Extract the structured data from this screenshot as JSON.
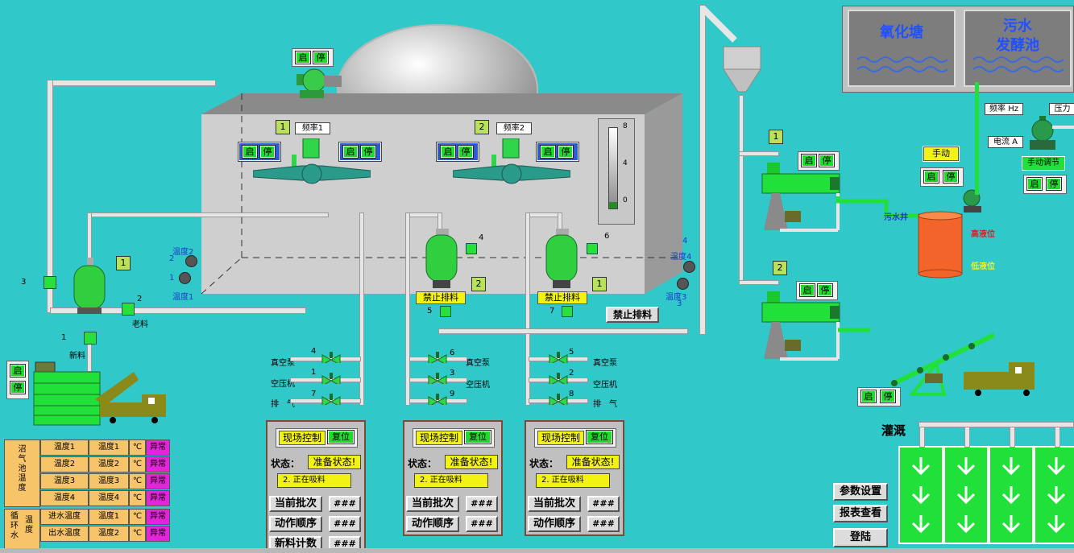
{
  "tanks": {
    "oxidation_pond": "氧化塘",
    "sewage_tank_line1": "污水",
    "sewage_tank_line2": "发酵池"
  },
  "buttons": {
    "start": "启",
    "stop": "停"
  },
  "digester": {
    "motor1_tag": "1",
    "motor1_label": "频率1",
    "motor2_tag": "2",
    "motor2_label": "频率2",
    "gauge_ticks": [
      "8",
      "4",
      "0"
    ],
    "temp2": "温度2",
    "temp2_num": "2",
    "temp1": "温度1",
    "temp1_num": "1",
    "temp3": "温度3",
    "temp3_num": "3",
    "temp4": "温度4",
    "temp4_num": "4"
  },
  "feed": {
    "tag1": "1",
    "valve3": "3",
    "valve2": "2",
    "valve1": "1",
    "old_feed": "老料",
    "new_feed": "新料"
  },
  "discharge": {
    "tank2_tag": "2",
    "tank1_tag": "1",
    "valve4": "4",
    "valve6": "6",
    "valve5": "5",
    "valve7": "7",
    "forbid_left": "禁止排料",
    "forbid_right": "禁止排料",
    "forbid_main": "禁止排料"
  },
  "valve_groups": [
    {
      "items": [
        {
          "num": "4",
          "label": "真空泵"
        },
        {
          "num": "1",
          "label": "空压机"
        },
        {
          "num": "7",
          "label": "排　气"
        }
      ]
    },
    {
      "items": [
        {
          "num": "6",
          "label": "真空泵"
        },
        {
          "num": "3",
          "label": "空压机"
        },
        {
          "num": "9",
          "label": "排　气"
        }
      ]
    },
    {
      "items": [
        {
          "num": "5",
          "label": "真空泵"
        },
        {
          "num": "2",
          "label": "空压机"
        },
        {
          "num": "8",
          "label": "排　气"
        }
      ]
    }
  ],
  "control_panels": [
    {
      "site": "现场控制",
      "reset": "复位",
      "state_label": "状态：",
      "state": "准备状态!",
      "msg": "2. 正在吸料",
      "batch": "当前批次",
      "batch_val": "###",
      "seq": "动作顺序",
      "seq_val": "###",
      "count": "新料计数",
      "count_val": "###"
    },
    {
      "site": "现场控制",
      "reset": "复位",
      "state_label": "状态：",
      "state": "准备状态!",
      "msg": "2. 正在吸料",
      "batch": "当前批次",
      "batch_val": "###",
      "seq": "动作顺序",
      "seq_val": "###"
    },
    {
      "site": "现场控制",
      "reset": "复位",
      "state_label": "状态：",
      "state": "准备状态!",
      "msg": "2. 正在吸料",
      "batch": "当前批次",
      "batch_val": "###",
      "seq": "动作顺序",
      "seq_val": "###"
    }
  ],
  "temp_table": {
    "group1_label": "沼气池温度",
    "rows": [
      {
        "name": "温度1",
        "val": "温度1",
        "unit": "℃",
        "status": "异常"
      },
      {
        "name": "温度2",
        "val": "温度2",
        "unit": "℃",
        "status": "异常"
      },
      {
        "name": "温度3",
        "val": "温度3",
        "unit": "℃",
        "status": "异常"
      },
      {
        "name": "温度4",
        "val": "温度4",
        "unit": "℃",
        "status": "异常"
      }
    ],
    "group2_label1": "循环水",
    "group2_label2": "温度",
    "rows2": [
      {
        "name": "进水温度",
        "val": "温度1",
        "unit": "℃",
        "status": "异常"
      },
      {
        "name": "出水温度",
        "val": "温度2",
        "unit": "℃",
        "status": "异常"
      }
    ]
  },
  "right": {
    "freq": "频率 Hz",
    "current": "电流 A",
    "pressure": "压力",
    "manual": "手动",
    "manual_adjust": "手动调节",
    "screw1_tag": "1",
    "screw2_tag": "2",
    "sewage_well": "污水井",
    "high_level": "高液位",
    "low_level": "低液位",
    "irrigation": "灌溉"
  },
  "nav": {
    "params": "参数设置",
    "reports": "报表查看",
    "login": "登陆"
  },
  "colors": {
    "background": "#30c8c8",
    "start_button": "#1fdc2c",
    "alarm": "#e424d8",
    "status_yellow": "#f2f215"
  }
}
